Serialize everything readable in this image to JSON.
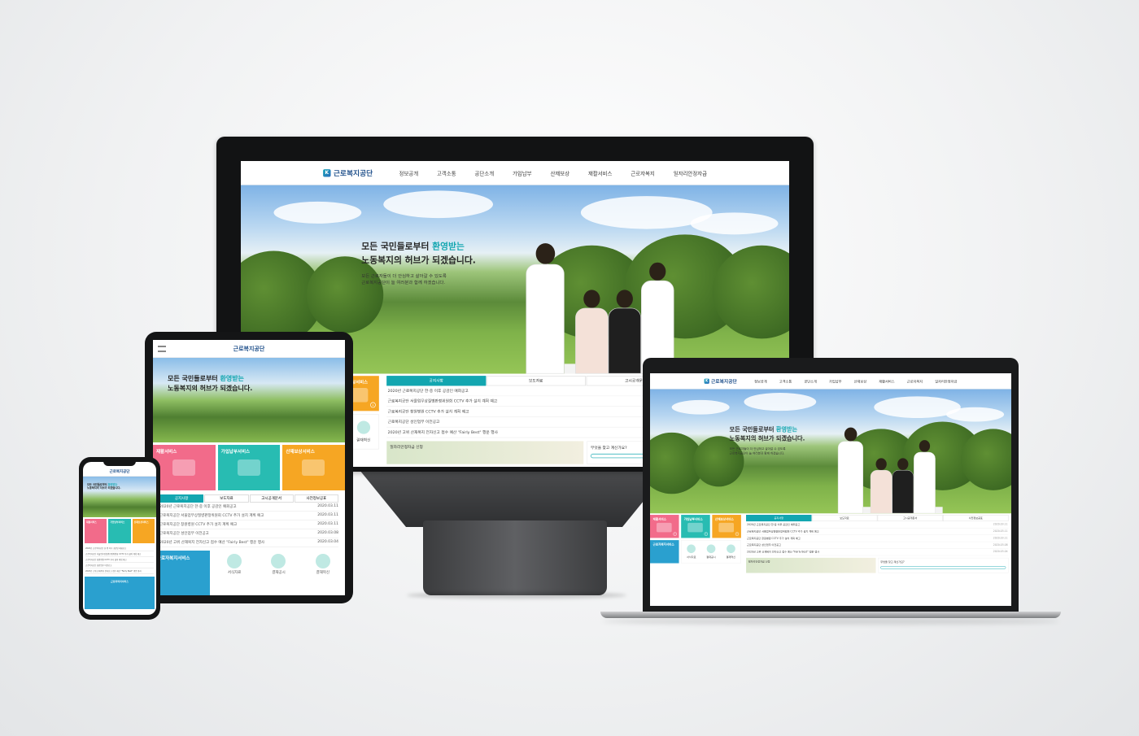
{
  "site": {
    "logo": "근로복지공단",
    "menu": [
      "정보공개",
      "고객소통",
      "공단소개",
      "가입납부",
      "산재보상",
      "재활서비스",
      "근로자복지",
      "일자리안정자금"
    ],
    "hero": {
      "title_line1_pre": "모든 국민들로부터",
      "title_line1_accent": "환영받는",
      "title_line2": "노동복지의 허브가 되겠습니다.",
      "sub_line1": "모든 근로자들이 더 안심하고 살아갈 수 있도록",
      "sub_line2": "근로복지공단이 늘 여러분과 함께 하겠습니다."
    },
    "tiles": [
      {
        "label": "재활서비스",
        "color": "#f26b8a"
      },
      {
        "label": "가입납부서비스",
        "color": "#28bcb2"
      },
      {
        "label": "산재보상서비스",
        "color": "#f6a623"
      },
      {
        "label": "근로자복지서비스",
        "color": "#2aa0cf"
      }
    ],
    "icon_links": [
      "서식자료",
      "결재공시",
      "결재혁신"
    ],
    "notice_tabs": [
      "공지사항",
      "보도자료",
      "고시공개문서",
      "사전정보공표"
    ],
    "notices": [
      {
        "title": "2020년 근로복지공단 한·중 이후 공감인 예회공고",
        "date": "2020.03.11"
      },
      {
        "title": "근로복지공단 서울업무상질병판정위원회 CCTV 추가 설치 계획 예고",
        "date": "2020.03.11"
      },
      {
        "title": "근로복지공단 창원병원 CCTV 추가 설치 계획 예고",
        "date": "2020.03.11"
      },
      {
        "title": "근로복지공단 성인업무 이전공고",
        "date": "2020.03.08"
      },
      {
        "title": "2020년 고위 산재복지 전자신고 접수 예산 \"Fairly Best\" 행운 행사",
        "date": "2020.03.04"
      }
    ],
    "banners": {
      "support": "일자리안정자금 신청",
      "ask": "무엇을 찾고 계신가요?"
    }
  }
}
